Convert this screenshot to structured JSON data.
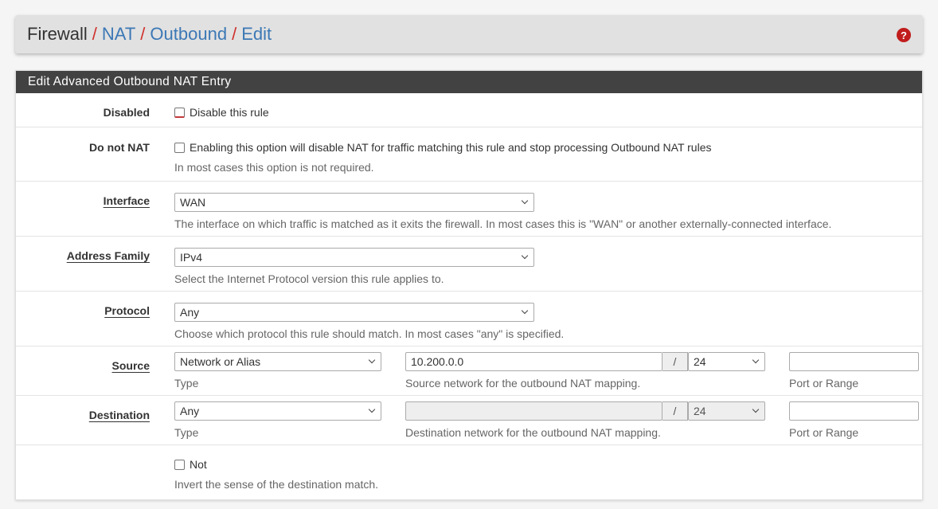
{
  "breadcrumb": {
    "items": [
      "Firewall",
      "NAT",
      "Outbound",
      "Edit"
    ],
    "separator": "/"
  },
  "help_icon": "?",
  "panel": {
    "title": "Edit Advanced Outbound NAT Entry"
  },
  "form": {
    "disabled": {
      "label": "Disabled",
      "checkbox_label": "Disable this rule",
      "checked": false
    },
    "do_not_nat": {
      "label": "Do not NAT",
      "checkbox_label": "Enabling this option will disable NAT for traffic matching this rule and stop processing Outbound NAT rules",
      "help": "In most cases this option is not required.",
      "checked": false
    },
    "interface": {
      "label": "Interface",
      "value": "WAN",
      "help": "The interface on which traffic is matched as it exits the firewall. In most cases this is \"WAN\" or another externally-connected interface."
    },
    "address_family": {
      "label": "Address Family",
      "value": "IPv4",
      "help": "Select the Internet Protocol version this rule applies to."
    },
    "protocol": {
      "label": "Protocol",
      "value": "Any",
      "help": "Choose which protocol this rule should match. In most cases \"any\" is specified."
    },
    "source": {
      "label": "Source",
      "type_value": "Network or Alias",
      "type_help": "Type",
      "network_value": "10.200.0.0",
      "slash": "/",
      "mask_value": "24",
      "network_help": "Source network for the outbound NAT mapping.",
      "port_value": "",
      "port_help": "Port or Range"
    },
    "destination": {
      "label": "Destination",
      "type_value": "Any",
      "type_help": "Type",
      "network_value": "",
      "slash": "/",
      "mask_value": "24",
      "network_help": "Destination network for the outbound NAT mapping.",
      "port_value": "",
      "port_help": "Port or Range"
    },
    "not": {
      "checkbox_label": "Not",
      "help": "Invert the sense of the destination match.",
      "checked": false
    }
  },
  "colors": {
    "heading_bg": "#424242",
    "breadcrumb_link": "#3c78b5",
    "separator": "#d0312d",
    "help_icon": "#c11d1d"
  }
}
